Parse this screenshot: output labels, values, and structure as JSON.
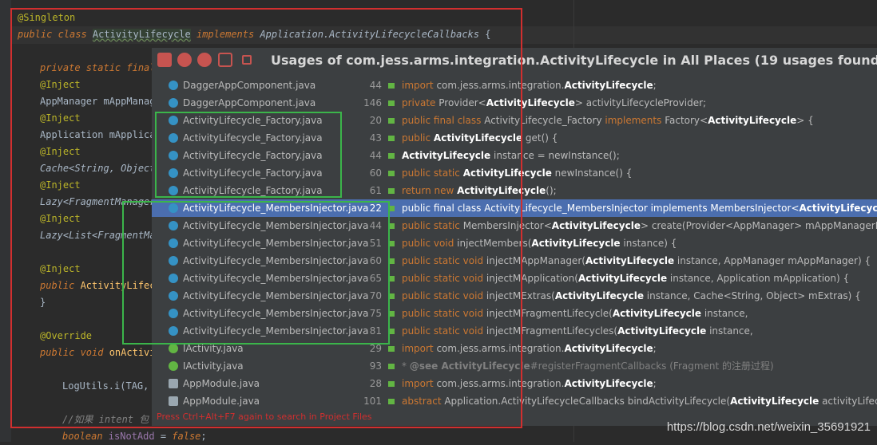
{
  "editor": {
    "lines": {
      "singleton": "@Singleton",
      "class_public": "public class ",
      "class_name": "ActivityLifecycle",
      "class_implements": " implements ",
      "class_iface": "Application.ActivityLifecycleCallbacks",
      "class_brace": " {",
      "private_static": "private static final",
      "inject1": "@Inject",
      "appmanager": "AppManager mAppManag",
      "inject2": "@Inject",
      "application": "Application mApplica",
      "inject3": "@Inject",
      "cache": "Cache<String, Object",
      "inject4": "@Inject",
      "lazy_fm": "Lazy<FragmentManager",
      "inject5": "@Inject",
      "lazy_list": "Lazy<List<FragmentMa",
      "inject6": "@Inject",
      "public_ctor_kw": "public",
      "public_ctor_name": " ActivityLifec",
      "close_brace": "}",
      "override": "@Override",
      "public_void": "public void ",
      "on_activity": "onActivi",
      "logutils": "LogUtils.i(TAG,",
      "comment": "//如果 intent 包",
      "boolean_kw": "boolean ",
      "is_not_add": "isNotAdd",
      "assign": " = ",
      "false_kw": "false",
      "semicolon": ";"
    }
  },
  "popup": {
    "title": "Usages of com.jess.arms.integration.ActivityLifecycle in All Places (19 usages found)",
    "hint": "Press Ctrl+Alt+F7 again to search in Project Files",
    "toolbar_icons": [
      "pin-icon",
      "navigate-back-icon",
      "navigate-forward-icon",
      "group-icon",
      "settings-icon"
    ],
    "rows": [
      {
        "file": "DaggerAppComponent.java",
        "line": "44",
        "icon": "class-icon",
        "snippet": [
          [
            "k",
            "import "
          ],
          [
            "n",
            "com.jess.arms.integration."
          ],
          [
            "b",
            "ActivityLifecycle"
          ],
          [
            "n",
            ";"
          ]
        ]
      },
      {
        "file": "DaggerAppComponent.java",
        "line": "146",
        "icon": "class-icon",
        "snippet": [
          [
            "k",
            "private "
          ],
          [
            "n",
            "Provider<"
          ],
          [
            "b",
            "ActivityLifecycle"
          ],
          [
            "n",
            "> activityLifecycleProvider;"
          ]
        ]
      },
      {
        "file": "ActivityLifecycle_Factory.java",
        "line": "20",
        "icon": "class-icon",
        "snippet": [
          [
            "k",
            "public final class "
          ],
          [
            "n",
            "ActivityLifecycle_Factory "
          ],
          [
            "k",
            "implements "
          ],
          [
            "n",
            "Factory<"
          ],
          [
            "b",
            "ActivityLifecycle"
          ],
          [
            "n",
            "> {"
          ]
        ]
      },
      {
        "file": "ActivityLifecycle_Factory.java",
        "line": "43",
        "icon": "class-icon",
        "snippet": [
          [
            "k",
            "public "
          ],
          [
            "b",
            "ActivityLifecycle"
          ],
          [
            "n",
            " get() {"
          ]
        ]
      },
      {
        "file": "ActivityLifecycle_Factory.java",
        "line": "44",
        "icon": "class-icon",
        "snippet": [
          [
            "b",
            "ActivityLifecycle"
          ],
          [
            "n",
            " instance = newInstance();"
          ]
        ]
      },
      {
        "file": "ActivityLifecycle_Factory.java",
        "line": "60",
        "icon": "class-icon",
        "snippet": [
          [
            "k",
            "public static "
          ],
          [
            "b",
            "ActivityLifecycle"
          ],
          [
            "n",
            " newInstance() {"
          ]
        ]
      },
      {
        "file": "ActivityLifecycle_Factory.java",
        "line": "61",
        "icon": "class-icon",
        "snippet": [
          [
            "k",
            "return new "
          ],
          [
            "b",
            "ActivityLifecycle"
          ],
          [
            "n",
            "();"
          ]
        ]
      },
      {
        "file": "ActivityLifecycle_MembersInjector.java",
        "line": "22",
        "icon": "class-icon",
        "selected": true,
        "snippet": [
          [
            "k",
            "public final class "
          ],
          [
            "n",
            "ActivityLifecycle_MembersInjector "
          ],
          [
            "k",
            "implements "
          ],
          [
            "n",
            "MembersInjector<"
          ],
          [
            "b",
            "ActivityLifecycle"
          ],
          [
            "n",
            "> {"
          ]
        ]
      },
      {
        "file": "ActivityLifecycle_MembersInjector.java",
        "line": "44",
        "icon": "class-icon",
        "snippet": [
          [
            "k",
            "public static "
          ],
          [
            "n",
            "MembersInjector<"
          ],
          [
            "b",
            "ActivityLifecycle"
          ],
          [
            "n",
            "> create(Provider<AppManager> mAppManagerProv"
          ]
        ]
      },
      {
        "file": "ActivityLifecycle_MembersInjector.java",
        "line": "51",
        "icon": "class-icon",
        "snippet": [
          [
            "k",
            "public void "
          ],
          [
            "n",
            "injectMembers("
          ],
          [
            "b",
            "ActivityLifecycle"
          ],
          [
            "n",
            " instance) {"
          ]
        ]
      },
      {
        "file": "ActivityLifecycle_MembersInjector.java",
        "line": "60",
        "icon": "class-icon",
        "snippet": [
          [
            "k",
            "public static void "
          ],
          [
            "n",
            "injectMAppManager("
          ],
          [
            "b",
            "ActivityLifecycle"
          ],
          [
            "n",
            " instance, AppManager mAppManager) {"
          ]
        ]
      },
      {
        "file": "ActivityLifecycle_MembersInjector.java",
        "line": "65",
        "icon": "class-icon",
        "snippet": [
          [
            "k",
            "public static void "
          ],
          [
            "n",
            "injectMApplication("
          ],
          [
            "b",
            "ActivityLifecycle"
          ],
          [
            "n",
            " instance, Application mApplication) {"
          ]
        ]
      },
      {
        "file": "ActivityLifecycle_MembersInjector.java",
        "line": "70",
        "icon": "class-icon",
        "snippet": [
          [
            "k",
            "public static void "
          ],
          [
            "n",
            "injectMExtras("
          ],
          [
            "b",
            "ActivityLifecycle"
          ],
          [
            "n",
            " instance, Cache<String, Object> mExtras) {"
          ]
        ]
      },
      {
        "file": "ActivityLifecycle_MembersInjector.java",
        "line": "75",
        "icon": "class-icon",
        "snippet": [
          [
            "k",
            "public static void "
          ],
          [
            "n",
            "injectMFragmentLifecycle("
          ],
          [
            "b",
            "ActivityLifecycle"
          ],
          [
            "n",
            " instance,"
          ]
        ]
      },
      {
        "file": "ActivityLifecycle_MembersInjector.java",
        "line": "81",
        "icon": "class-icon",
        "snippet": [
          [
            "k",
            "public static void "
          ],
          [
            "n",
            "injectMFragmentLifecycles("
          ],
          [
            "b",
            "ActivityLifecycle"
          ],
          [
            "n",
            " instance,"
          ]
        ]
      },
      {
        "file": "IActivity.java",
        "line": "29",
        "icon": "interface-icon",
        "snippet": [
          [
            "k",
            "import "
          ],
          [
            "n",
            "com.jess.arms.integration."
          ],
          [
            "b",
            "ActivityLifecycle"
          ],
          [
            "n",
            ";"
          ]
        ]
      },
      {
        "file": "IActivity.java",
        "line": "93",
        "icon": "interface-icon",
        "snippet": [
          [
            "c",
            "* "
          ],
          [
            "cb",
            "@see "
          ],
          [
            "cb",
            "ActivityLifecycle"
          ],
          [
            "c",
            "#registerFragmentCallbacks (Fragment 的注册过程)"
          ]
        ]
      },
      {
        "file": "AppModule.java",
        "line": "28",
        "icon": "module-icon",
        "snippet": [
          [
            "k",
            "import "
          ],
          [
            "n",
            "com.jess.arms.integration."
          ],
          [
            "b",
            "ActivityLifecycle"
          ],
          [
            "n",
            ";"
          ]
        ]
      },
      {
        "file": "AppModule.java",
        "line": "101",
        "icon": "module-icon",
        "snippet": [
          [
            "k",
            "abstract "
          ],
          [
            "n",
            "Application.ActivityLifecycleCallbacks bindActivityLifecycle("
          ],
          [
            "b",
            "ActivityLifecycle"
          ],
          [
            "n",
            " activityLifecycle);"
          ]
        ]
      }
    ]
  },
  "watermark": "https://blog.csdn.net/weixin_35691921"
}
